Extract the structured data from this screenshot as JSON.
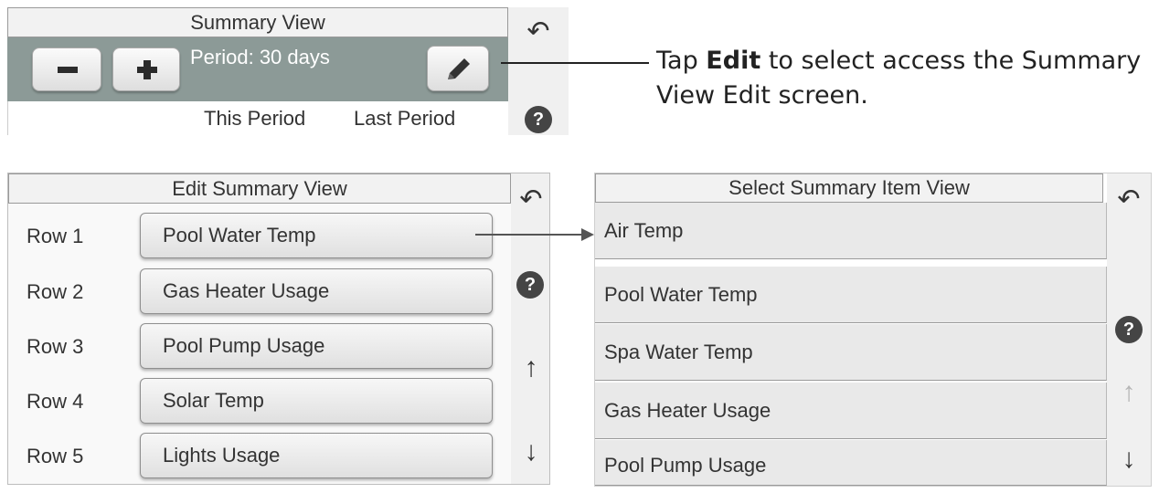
{
  "summary_view": {
    "title": "Summary View",
    "minus_label": "−",
    "plus_label": "+",
    "period": "Period: 30 days",
    "col_this": "This Period",
    "col_last": "Last Period"
  },
  "callout": {
    "pre": "Tap ",
    "bold": "Edit",
    "post": " to select access the Summary View Edit screen."
  },
  "edit_summary_view": {
    "title": "Edit Summary View",
    "rows": [
      {
        "label": "Row 1",
        "value": "Pool Water Temp"
      },
      {
        "label": "Row 2",
        "value": "Gas Heater Usage"
      },
      {
        "label": "Row 3",
        "value": "Pool Pump Usage"
      },
      {
        "label": "Row 4",
        "value": "Solar Temp"
      },
      {
        "label": "Row 5",
        "value": "Lights Usage"
      }
    ]
  },
  "select_summary_item_view": {
    "title": "Select Summary Item View",
    "items": [
      "Air Temp",
      "Pool Water Temp",
      "Spa Water Temp",
      "Gas Heater Usage",
      "Pool Pump Usage"
    ]
  },
  "icons": {
    "back": "↶",
    "help": "?",
    "up": "↑",
    "down": "↓",
    "edit": "pencil-icon"
  },
  "colors": {
    "toolbar_bg": "#8c9a97",
    "button_bg": "#e8e8e8"
  }
}
